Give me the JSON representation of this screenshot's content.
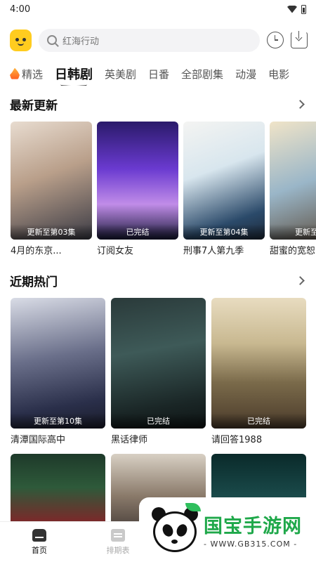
{
  "status_bar": {
    "time": "4:00"
  },
  "search": {
    "placeholder": "红海行动"
  },
  "tabs": [
    {
      "label": "精选",
      "icon": "flame-icon"
    },
    {
      "label": "日韩剧",
      "active": true
    },
    {
      "label": "英美剧"
    },
    {
      "label": "日番"
    },
    {
      "label": "全部剧集"
    },
    {
      "label": "动漫"
    },
    {
      "label": "电影"
    }
  ],
  "sections": {
    "latest": {
      "title": "最新更新",
      "items": [
        {
          "title": "4月的东京...",
          "badge": "更新至第03集"
        },
        {
          "title": "订阅女友",
          "badge": "已完结"
        },
        {
          "title": "刑事7人第九季",
          "badge": "更新至第04集"
        },
        {
          "title": "甜蜜的宽恕",
          "badge": "更新至第"
        }
      ]
    },
    "hot": {
      "title": "近期热门",
      "items": [
        {
          "title": "清潭国际高中",
          "badge": "更新至第10集"
        },
        {
          "title": "黑话律师",
          "badge": "已完结"
        },
        {
          "title": "请回答1988",
          "badge": "已完结"
        }
      ]
    }
  },
  "bottom_nav": [
    {
      "label": "首页",
      "icon": "home-icon",
      "active": true
    },
    {
      "label": "排期表",
      "icon": "calendar-icon"
    }
  ],
  "watermark": {
    "title": "国宝手游网",
    "url": "- WWW.GB315.COM -"
  },
  "colors": {
    "accent": "#ffcc1f",
    "watermark_green": "#1fa84a"
  }
}
